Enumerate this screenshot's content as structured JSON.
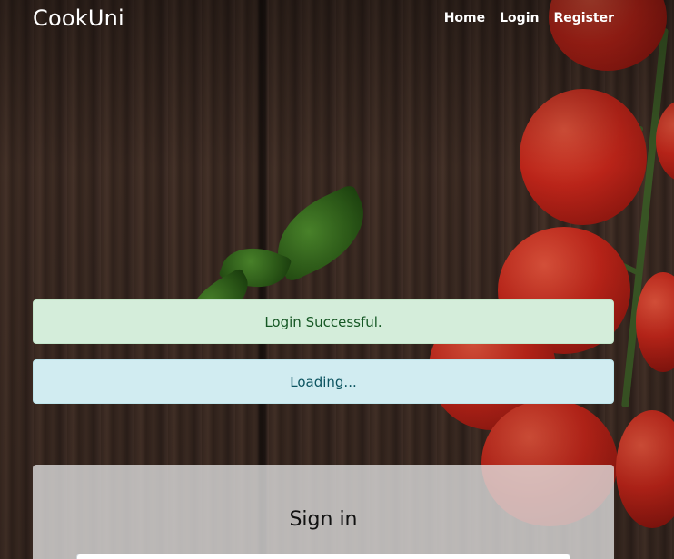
{
  "navbar": {
    "brand": "CookUni",
    "links": [
      {
        "label": "Home"
      },
      {
        "label": "Login"
      },
      {
        "label": "Register"
      }
    ]
  },
  "alerts": {
    "success": "Login Successful.",
    "info": "Loading..."
  },
  "signin": {
    "title": "Sign in"
  },
  "colors": {
    "success_bg": "#d4edda",
    "success_text": "#155724",
    "info_bg": "#d1ecf1",
    "info_text": "#0c5460"
  }
}
